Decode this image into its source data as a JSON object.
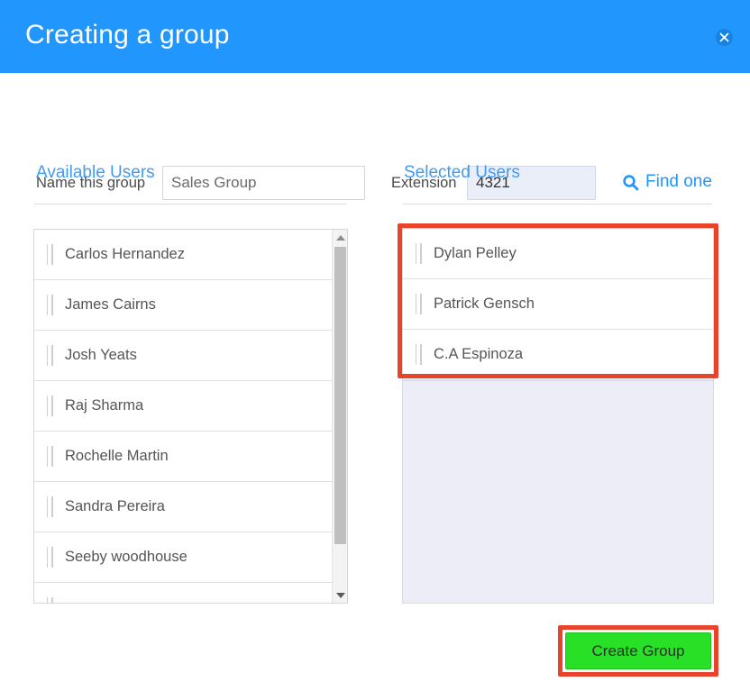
{
  "dialog": {
    "title": "Creating a group",
    "close_icon": "close-circle-icon",
    "accent_blue": "#2196fd",
    "link_blue": "#3f9bf5",
    "annotation_red": "#e8442b",
    "button_green": "#28e026"
  },
  "form": {
    "name_label": "Name this group",
    "name_value": "Sales Group",
    "name_placeholder": "Name this group",
    "extension_label": "Extension",
    "extension_value": "4321",
    "extension_placeholder": "Extension",
    "find_one_label": "Find one",
    "find_one_icon": "search-icon"
  },
  "available_users": {
    "heading": "Available Users",
    "items": [
      {
        "name": "Carlos Hernandez",
        "handle_icon": "drag-handle-icon"
      },
      {
        "name": "James Cairns",
        "handle_icon": "drag-handle-icon"
      },
      {
        "name": "Josh Yeats",
        "handle_icon": "drag-handle-icon"
      },
      {
        "name": "Raj Sharma",
        "handle_icon": "drag-handle-icon"
      },
      {
        "name": "Rochelle Martin",
        "handle_icon": "drag-handle-icon"
      },
      {
        "name": "Sandra Pereira",
        "handle_icon": "drag-handle-icon"
      },
      {
        "name": "Seeby woodhouse",
        "handle_icon": "drag-handle-icon"
      },
      {
        "name": "",
        "handle_icon": "drag-handle-icon"
      }
    ],
    "scrollbar": {
      "up_icon": "caret-up-icon",
      "down_icon": "caret-down-icon"
    }
  },
  "selected_users": {
    "heading": "Selected Users",
    "items": [
      {
        "name": "Dylan Pelley",
        "handle_icon": "drag-handle-icon"
      },
      {
        "name": "Patrick Gensch",
        "handle_icon": "drag-handle-icon"
      },
      {
        "name": "C.A Espinoza",
        "handle_icon": "drag-handle-icon"
      }
    ],
    "dropzone_placeholder": ""
  },
  "footer": {
    "create_label": "Create Group"
  }
}
